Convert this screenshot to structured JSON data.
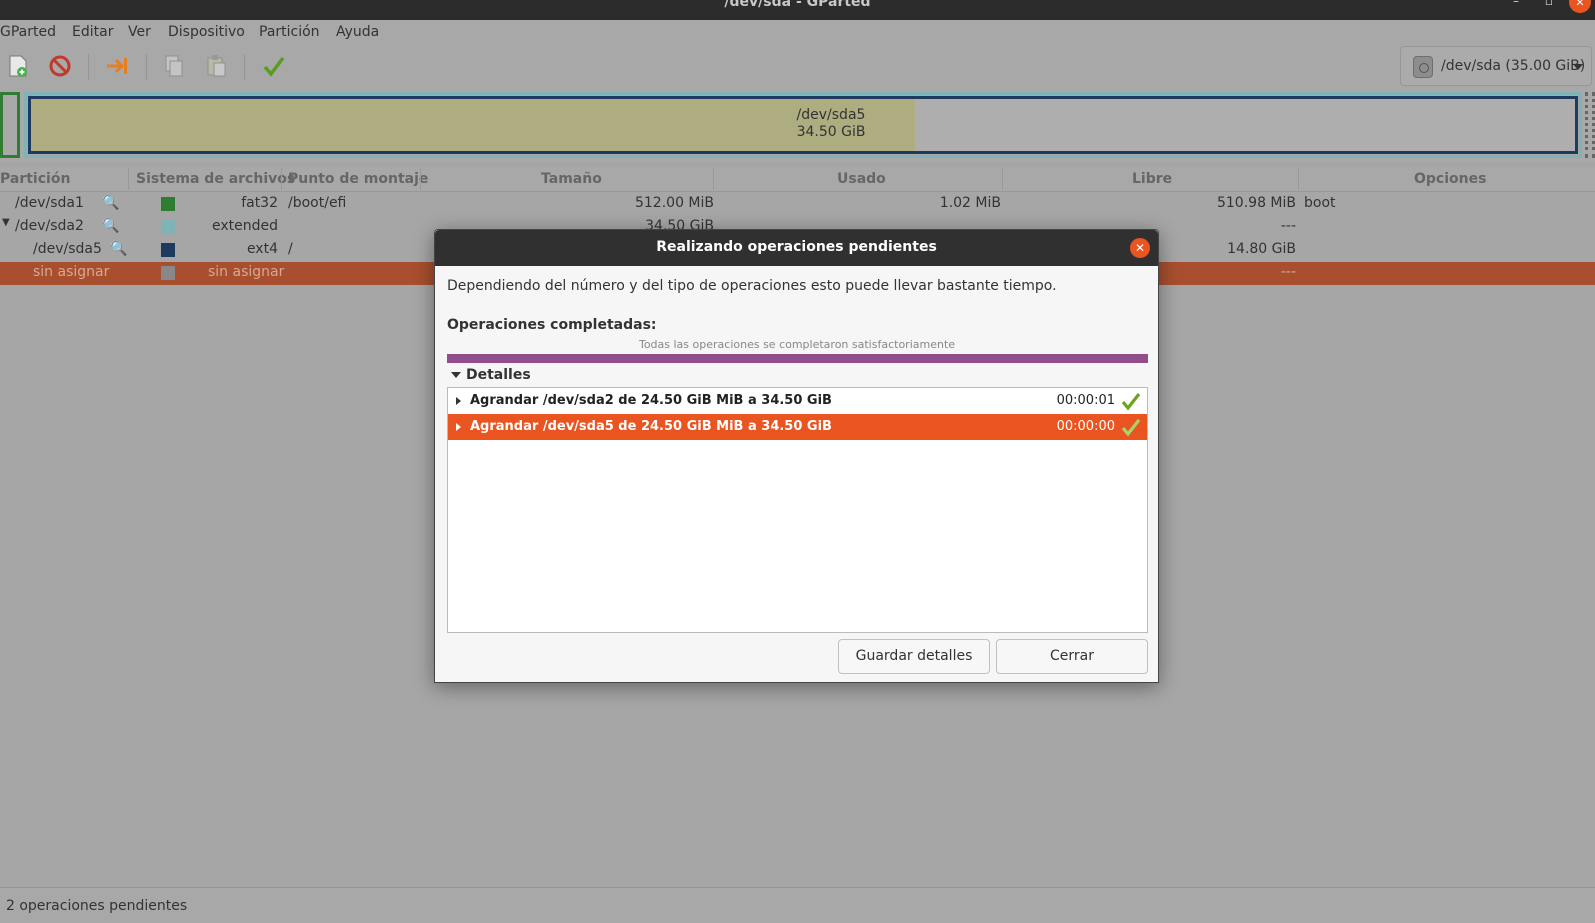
{
  "window": {
    "title": "/dev/sda - GParted",
    "min": "–",
    "max": "▫",
    "close": "✕"
  },
  "menu": [
    "GParted",
    "Editar",
    "Ver",
    "Dispositivo",
    "Partición",
    "Ayuda"
  ],
  "toolbar": {
    "buttons": [
      "new-icon",
      "delete-icon",
      "resize-move-icon",
      "copy-icon",
      "paste-icon",
      "apply-icon"
    ],
    "device_selector": "/dev/sda (35.00 GiB)"
  },
  "diskmap": {
    "label_name": "/dev/sda5",
    "label_size": "34.50 GiB"
  },
  "table": {
    "headers": [
      "Partición",
      "Sistema de archivos",
      "Punto de montaje",
      "Tamaño",
      "Usado",
      "Libre",
      "Opciones"
    ],
    "rows": [
      {
        "partition": "/dev/sda1",
        "color": "#2e7d32",
        "fs": "fat32",
        "mount": "/boot/efi",
        "size": "512.00 MiB",
        "used": "1.02 MiB",
        "free": "510.98 MiB",
        "flags": "boot"
      },
      {
        "partition": "/dev/sda2",
        "color": "#7fb3b8",
        "fs": "extended",
        "mount": "",
        "size": "34.50 GiB",
        "used": "",
        "free": "---",
        "flags": ""
      },
      {
        "partition": "/dev/sda5",
        "color": "#1e3a5f",
        "fs": "ext4",
        "mount": "/",
        "size": "",
        "used": "",
        "free": "14.80 GiB",
        "flags": ""
      },
      {
        "partition": "sin asignar",
        "color": "#888888",
        "fs": "sin asignar",
        "mount": "",
        "size": "",
        "used": "",
        "free": "---",
        "flags": ""
      }
    ]
  },
  "status": "2 operaciones pendientes",
  "dialog": {
    "title": "Realizando operaciones pendientes",
    "message": "Dependiendo del número y del tipo de operaciones esto puede llevar bastante tiempo.",
    "completed_label": "Operaciones completadas:",
    "progress_text": "Todas las operaciones se completaron satisfactoriamente",
    "progress": 1.0,
    "details_label": "Detalles",
    "operations": [
      {
        "label": "Agrandar /dev/sda2 de 24.50 GiB MiB a 34.50 GiB",
        "time": "00:00:01"
      },
      {
        "label": "Agrandar /dev/sda5 de 24.50 GiB MiB a 34.50 GiB",
        "time": "00:00:00"
      }
    ],
    "save_button": "Guardar detalles",
    "close_button": "Cerrar"
  }
}
